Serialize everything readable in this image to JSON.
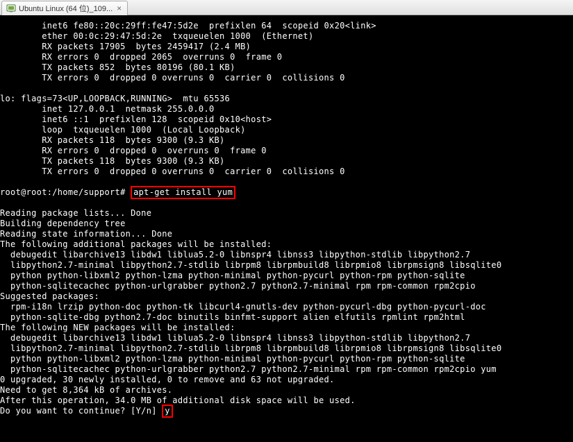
{
  "tab": {
    "title": "Ubuntu Linux (64 位)_109...",
    "close_label": "×"
  },
  "terminal": {
    "lines": [
      "        inet6 fe80::20c:29ff:fe47:5d2e  prefixlen 64  scopeid 0x20<link>",
      "        ether 00:0c:29:47:5d:2e  txqueuelen 1000  (Ethernet)",
      "        RX packets 17905  bytes 2459417 (2.4 MB)",
      "        RX errors 0  dropped 2065  overruns 0  frame 0",
      "        TX packets 852  bytes 80196 (80.1 KB)",
      "        TX errors 0  dropped 0 overruns 0  carrier 0  collisions 0",
      "",
      "lo: flags=73<UP,LOOPBACK,RUNNING>  mtu 65536",
      "        inet 127.0.0.1  netmask 255.0.0.0",
      "        inet6 ::1  prefixlen 128  scopeid 0x10<host>",
      "        loop  txqueuelen 1000  (Local Loopback)",
      "        RX packets 118  bytes 9300 (9.3 KB)",
      "        RX errors 0  dropped 0  overruns 0  frame 0",
      "        TX packets 118  bytes 9300 (9.3 KB)",
      "        TX errors 0  dropped 0 overruns 0  carrier 0  collisions 0",
      ""
    ],
    "prompt_prefix": "root@root:/home/support# ",
    "command": "apt-get install yum",
    "after_command": [
      "Reading package lists... Done",
      "Building dependency tree",
      "Reading state information... Done",
      "The following additional packages will be installed:",
      "  debugedit libarchive13 libdw1 liblua5.2-0 libnspr4 libnss3 libpython-stdlib libpython2.7",
      "  libpython2.7-minimal libpython2.7-stdlib librpm8 librpmbuild8 librpmio8 librpmsign8 libsqlite0",
      "  python python-libxml2 python-lzma python-minimal python-pycurl python-rpm python-sqlite",
      "  python-sqlitecachec python-urlgrabber python2.7 python2.7-minimal rpm rpm-common rpm2cpio",
      "Suggested packages:",
      "  rpm-i18n lrzip python-doc python-tk libcurl4-gnutls-dev python-pycurl-dbg python-pycurl-doc",
      "  python-sqlite-dbg python2.7-doc binutils binfmt-support alien elfutils rpmlint rpm2html",
      "The following NEW packages will be installed:",
      "  debugedit libarchive13 libdw1 liblua5.2-0 libnspr4 libnss3 libpython-stdlib libpython2.7",
      "  libpython2.7-minimal libpython2.7-stdlib librpm8 librpmbuild8 librpmio8 librpmsign8 libsqlite0",
      "  python python-libxml2 python-lzma python-minimal python-pycurl python-rpm python-sqlite",
      "  python-sqlitecachec python-urlgrabber python2.7 python2.7-minimal rpm rpm-common rpm2cpio yum",
      "0 upgraded, 30 newly installed, 0 to remove and 63 not upgraded.",
      "Need to get 8,364 kB of archives.",
      "After this operation, 34.0 MB of additional disk space will be used."
    ],
    "confirm_prefix": "Do you want to continue? [Y/n] ",
    "confirm_input": "y"
  }
}
